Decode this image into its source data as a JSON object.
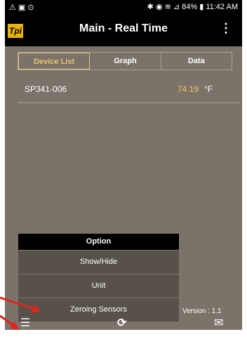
{
  "status_bar": {
    "left_icons": "⚠ ▣ ⊙",
    "right_text": "✱ ◉ ≋ ⊿ 84% ▮ 11:42 AM"
  },
  "app_bar": {
    "logo_text": "Tpi",
    "title": "Main - Real Time",
    "overflow_icon": "⋮"
  },
  "tabs": [
    {
      "label": "Device List",
      "active": true
    },
    {
      "label": "Graph",
      "active": false
    },
    {
      "label": "Data",
      "active": false
    }
  ],
  "devices": [
    {
      "name": "SP341-006",
      "value": "74.19",
      "unit": "°F"
    }
  ],
  "option_menu": {
    "header": "Option",
    "items": [
      "Show/Hide",
      "Unit",
      "Zeroing Sensors"
    ]
  },
  "version_text": "Version : 1.1",
  "bottom_bar": {
    "menu_icon": "☰",
    "refresh_icon": "⟳",
    "mail_icon": "✉"
  },
  "colors": {
    "background": "#7b736a",
    "active_tab": "#e9c46a",
    "value_text": "#f0c860",
    "annotation_arrow": "#e2231a"
  }
}
